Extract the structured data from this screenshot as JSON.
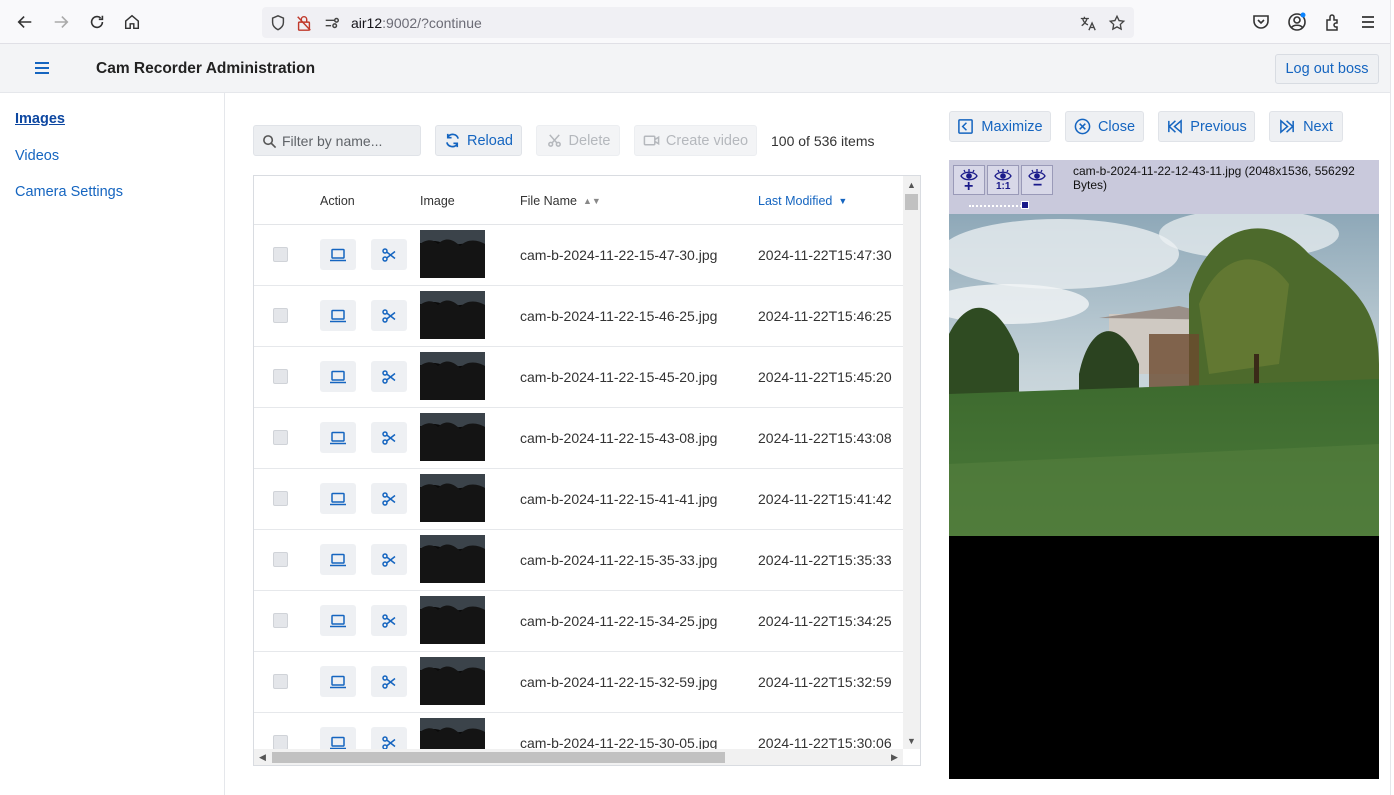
{
  "browser": {
    "url_host": "air12",
    "url_rest": ":9002/?continue"
  },
  "header": {
    "title": "Cam Recorder Administration",
    "logout_label": "Log out boss"
  },
  "sidebar": {
    "items": [
      {
        "label": "Images",
        "active": true
      },
      {
        "label": "Videos",
        "active": false
      },
      {
        "label": "Camera Settings",
        "active": false
      }
    ]
  },
  "toolbar": {
    "filter_placeholder": "Filter by name...",
    "reload_label": "Reload",
    "delete_label": "Delete",
    "create_video_label": "Create video",
    "count_text": "100 of 536 items"
  },
  "table": {
    "columns": {
      "action": "Action",
      "image": "Image",
      "file_name": "File Name",
      "last_modified": "Last Modified"
    },
    "rows": [
      {
        "file": "cam-b-2024-11-22-15-47-30.jpg",
        "modified": "2024-11-22T15:47:30"
      },
      {
        "file": "cam-b-2024-11-22-15-46-25.jpg",
        "modified": "2024-11-22T15:46:25"
      },
      {
        "file": "cam-b-2024-11-22-15-45-20.jpg",
        "modified": "2024-11-22T15:45:20"
      },
      {
        "file": "cam-b-2024-11-22-15-43-08.jpg",
        "modified": "2024-11-22T15:43:08"
      },
      {
        "file": "cam-b-2024-11-22-15-41-41.jpg",
        "modified": "2024-11-22T15:41:42"
      },
      {
        "file": "cam-b-2024-11-22-15-35-33.jpg",
        "modified": "2024-11-22T15:35:33"
      },
      {
        "file": "cam-b-2024-11-22-15-34-25.jpg",
        "modified": "2024-11-22T15:34:25"
      },
      {
        "file": "cam-b-2024-11-22-15-32-59.jpg",
        "modified": "2024-11-22T15:32:59"
      },
      {
        "file": "cam-b-2024-11-22-15-30-05.jpg",
        "modified": "2024-11-22T15:30:06"
      }
    ]
  },
  "viewer": {
    "maximize_label": "Maximize",
    "close_label": "Close",
    "previous_label": "Previous",
    "next_label": "Next",
    "caption": "cam-b-2024-11-22-12-43-11.jpg (2048x1536, 556292 Bytes)",
    "zoom_in_label": "+",
    "zoom_reset_label": "1:1",
    "zoom_out_label": "−"
  }
}
